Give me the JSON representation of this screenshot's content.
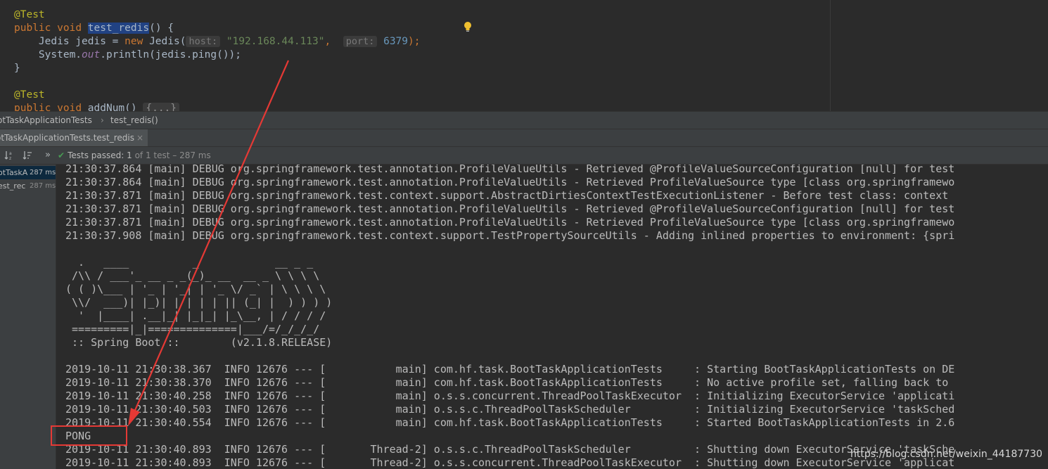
{
  "editor": {
    "line1": "@Test",
    "line2": {
      "kw1": "public",
      "kw2": "void",
      "method": "test_redis",
      "rest": "() {"
    },
    "line3": {
      "type": "Jedis jedis = ",
      "new": "new",
      "ctor": " Jedis(",
      "hint_host": "host:",
      "host": "\"192.168.44.113\"",
      "comma": ",",
      "hint_port": "port:",
      "port": "6379",
      "end": ");"
    },
    "line4": {
      "pre": "System.",
      "field": "out",
      "post": ".println(jedis.ping());"
    },
    "line5": "}",
    "line6": "@Test",
    "line7": {
      "kw1": "public",
      "kw2": "void",
      "method": "addNum()",
      "fold": "{...}"
    }
  },
  "breadcrumb": {
    "class": "otTaskApplicationTests",
    "sep": "›",
    "method": "test_redis()"
  },
  "run_tab": {
    "label": "otTaskApplicationTests.test_redis",
    "close": "×"
  },
  "toolbar": {
    "sort_alpha_icon": "sort-alpha-icon",
    "sort_duration_icon": "sort-duration-icon",
    "expand": "»",
    "status_prefix": "Tests passed:",
    "status_count": "1",
    "status_suffix": "of 1 test – 287 ms"
  },
  "tree": [
    {
      "name": "otTaskA",
      "time": "287 ms"
    },
    {
      "name": "est_rec",
      "time": "287 ms"
    }
  ],
  "console": {
    "log_lines": [
      "21:30:37.864 [main] DEBUG org.springframework.test.annotation.ProfileValueUtils - Retrieved @ProfileValueSourceConfiguration [null] for test",
      "21:30:37.864 [main] DEBUG org.springframework.test.annotation.ProfileValueUtils - Retrieved ProfileValueSource type [class org.springframewo",
      "21:30:37.871 [main] DEBUG org.springframework.test.context.support.AbstractDirtiesContextTestExecutionListener - Before test class: context",
      "21:30:37.871 [main] DEBUG org.springframework.test.annotation.ProfileValueUtils - Retrieved @ProfileValueSourceConfiguration [null] for test",
      "21:30:37.871 [main] DEBUG org.springframework.test.annotation.ProfileValueUtils - Retrieved ProfileValueSource type [class org.springframewo",
      "21:30:37.908 [main] DEBUG org.springframework.test.context.support.TestPropertySourceUtils - Adding inlined properties to environment: {spri"
    ],
    "banner": [
      "  .   ____          _            __ _ _",
      " /\\\\ / ___'_ __ _ _(_)_ __  __ _ \\ \\ \\ \\",
      "( ( )\\___ | '_ | '_| | '_ \\/ _` | \\ \\ \\ \\",
      " \\\\/  ___)| |_)| | | | | || (_| |  ) ) ) )",
      "  '  |____| .__|_| |_|_| |_\\__, | / / / /",
      " =========|_|==============|___/=/_/_/_/",
      " :: Spring Boot ::        (v2.1.8.RELEASE)"
    ],
    "info_lines": [
      "2019-10-11 21:30:38.367  INFO 12676 --- [           main] com.hf.task.BootTaskApplicationTests     : Starting BootTaskApplicationTests on DE",
      "2019-10-11 21:30:38.370  INFO 12676 --- [           main] com.hf.task.BootTaskApplicationTests     : No active profile set, falling back to",
      "2019-10-11 21:30:40.258  INFO 12676 --- [           main] o.s.s.concurrent.ThreadPoolTaskExecutor  : Initializing ExecutorService 'applicati",
      "2019-10-11 21:30:40.503  INFO 12676 --- [           main] o.s.s.c.ThreadPoolTaskScheduler          : Initializing ExecutorService 'taskSched",
      "2019-10-11 21:30:40.554  INFO 12676 --- [           main] com.hf.task.BootTaskApplicationTests     : Started BootTaskApplicationTests in 2.6"
    ],
    "pong": "PONG",
    "shutdown_lines": [
      "2019-10-11 21:30:40.893  INFO 12676 --- [       Thread-2] o.s.s.c.ThreadPoolTaskScheduler          : Shutting down ExecutorService 'taskSche",
      "2019-10-11 21:30:40.893  INFO 12676 --- [       Thread-2] o.s.s.concurrent.ThreadPoolTaskExecutor  : Shutting down ExecutorService 'applicat"
    ]
  },
  "watermark": "https://blog.csdn.net/weixin_44187730",
  "colors": {
    "annotation_red": "#e53935",
    "passed_green": "#499c54"
  }
}
